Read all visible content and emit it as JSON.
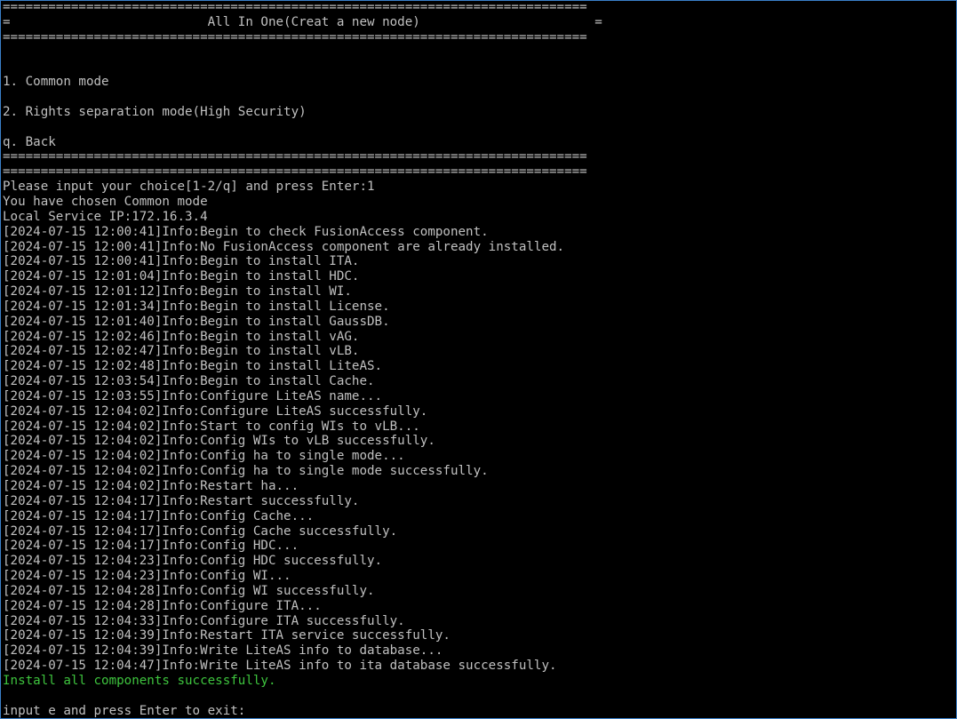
{
  "colors": {
    "background": "#000000",
    "text": "#c0c0c0",
    "success": "#3ec43e",
    "window_border": "#3a7fc8"
  },
  "menu": {
    "border": "=============================================================================",
    "title_line": "=                          All In One(Creat a new node)                       =",
    "options": [
      "1. Common mode",
      "2. Rights separation mode(High Security)",
      "q. Back"
    ]
  },
  "prompt_choice": "Please input your choice[1-2/q] and press Enter:1",
  "chosen": "You have chosen Common mode",
  "local_ip": "Local Service IP:172.16.3.4",
  "log": [
    "[2024-07-15 12:00:41]Info:Begin to check FusionAccess component.",
    "[2024-07-15 12:00:41]Info:No FusionAccess component are already installed.",
    "[2024-07-15 12:00:41]Info:Begin to install ITA.",
    "[2024-07-15 12:01:04]Info:Begin to install HDC.",
    "[2024-07-15 12:01:12]Info:Begin to install WI.",
    "[2024-07-15 12:01:34]Info:Begin to install License.",
    "[2024-07-15 12:01:40]Info:Begin to install GaussDB.",
    "[2024-07-15 12:02:46]Info:Begin to install vAG.",
    "[2024-07-15 12:02:47]Info:Begin to install vLB.",
    "[2024-07-15 12:02:48]Info:Begin to install LiteAS.",
    "[2024-07-15 12:03:54]Info:Begin to install Cache.",
    "[2024-07-15 12:03:55]Info:Configure LiteAS name...",
    "[2024-07-15 12:04:02]Info:Configure LiteAS successfully.",
    "[2024-07-15 12:04:02]Info:Start to config WIs to vLB...",
    "[2024-07-15 12:04:02]Info:Config WIs to vLB successfully.",
    "[2024-07-15 12:04:02]Info:Config ha to single mode...",
    "[2024-07-15 12:04:02]Info:Config ha to single mode successfully.",
    "[2024-07-15 12:04:02]Info:Restart ha...",
    "[2024-07-15 12:04:17]Info:Restart successfully.",
    "[2024-07-15 12:04:17]Info:Config Cache...",
    "[2024-07-15 12:04:17]Info:Config Cache successfully.",
    "[2024-07-15 12:04:17]Info:Config HDC...",
    "[2024-07-15 12:04:23]Info:Config HDC successfully.",
    "[2024-07-15 12:04:23]Info:Config WI...",
    "[2024-07-15 12:04:28]Info:Config WI successfully.",
    "[2024-07-15 12:04:28]Info:Configure ITA...",
    "[2024-07-15 12:04:33]Info:Configure ITA successfully.",
    "[2024-07-15 12:04:39]Info:Restart ITA service successfully.",
    "[2024-07-15 12:04:39]Info:Write LiteAS info to database...",
    "[2024-07-15 12:04:47]Info:Write LiteAS info to ita database successfully."
  ],
  "success_message": "Install all components successfully.",
  "exit_prompt": "input e and press Enter to exit:"
}
